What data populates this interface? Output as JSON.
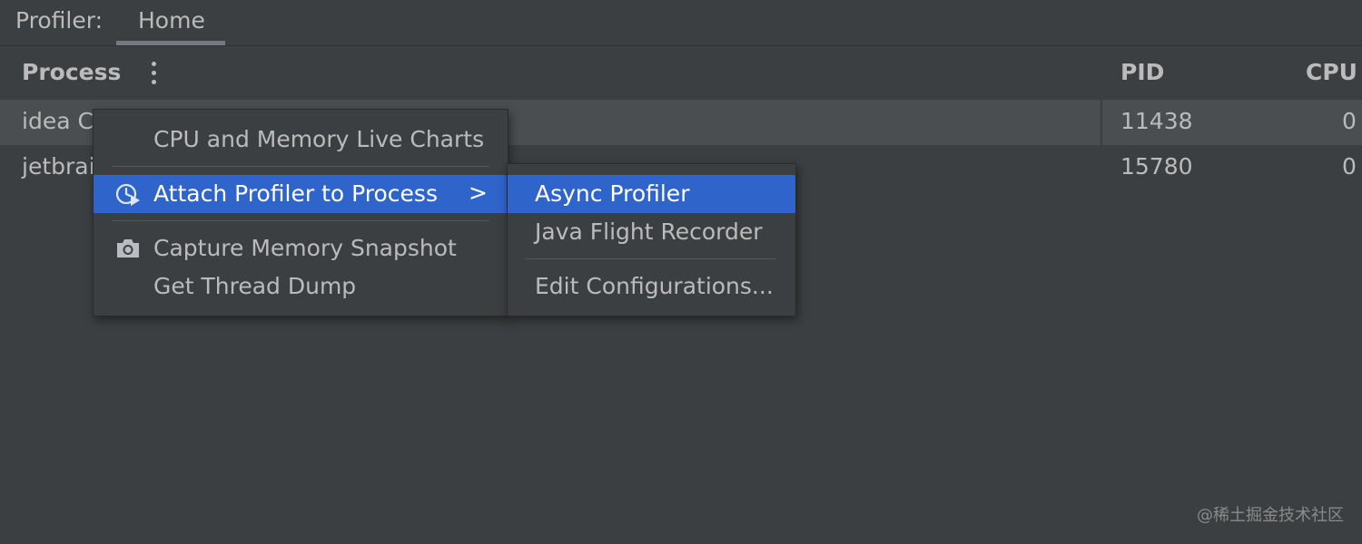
{
  "tabbar": {
    "label": "Profiler:",
    "tab_home": "Home"
  },
  "table": {
    "headers": {
      "process": "Process",
      "pid": "PID",
      "cpu": "CPU"
    },
    "rows": [
      {
        "process": "idea C",
        "pid": "11438",
        "cpu": "0",
        "selected": true
      },
      {
        "process": "jetbrai",
        "pid": "15780",
        "cpu": "0",
        "selected": false
      }
    ]
  },
  "context_menu": {
    "items": [
      {
        "label": "CPU and Memory Live Charts",
        "icon": null
      },
      {
        "label": "Attach Profiler to Process",
        "icon": "profiler-clock-icon",
        "has_submenu": true,
        "highlighted": true
      },
      {
        "label": "Capture Memory Snapshot",
        "icon": "camera-icon"
      },
      {
        "label": "Get Thread Dump",
        "icon": null
      }
    ],
    "submenu_arrow": ">"
  },
  "submenu": {
    "items": [
      {
        "label": "Async Profiler",
        "highlighted": true
      },
      {
        "label": "Java Flight Recorder"
      },
      {
        "label": "Edit Configurations..."
      }
    ]
  },
  "watermark": "@稀土掘金技术社区",
  "colors": {
    "background": "#3c3f41",
    "selected_row": "#4b4e51",
    "highlight": "#2f65ca",
    "text": "#bbbbbb"
  }
}
